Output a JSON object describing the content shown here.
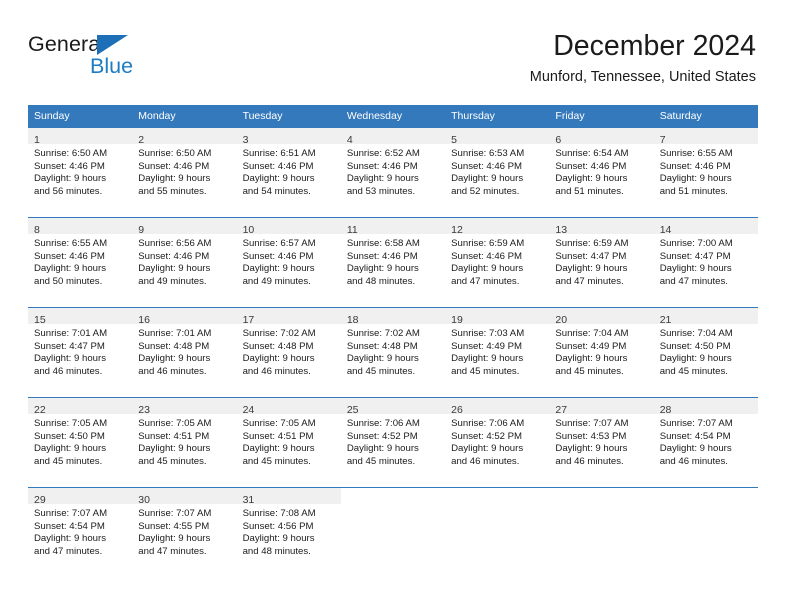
{
  "logo": {
    "text_primary": "General",
    "text_secondary": "Blue",
    "triangle_icon": "triangle-icon",
    "brand_color": "#1d7cc4"
  },
  "header": {
    "title": "December 2024",
    "subtitle": "Munford, Tennessee, United States"
  },
  "colors": {
    "header_blue": "#3579bd",
    "daynum_band": "#f0f0f0",
    "text": "#1b1b1b"
  },
  "calendar": {
    "weekday_headers": [
      "Sunday",
      "Monday",
      "Tuesday",
      "Wednesday",
      "Thursday",
      "Friday",
      "Saturday"
    ],
    "weeks": [
      [
        {
          "day": "1",
          "sunrise": "Sunrise: 6:50 AM",
          "sunset": "Sunset: 4:46 PM",
          "daylight_line1": "Daylight: 9 hours",
          "daylight_line2": "and 56 minutes."
        },
        {
          "day": "2",
          "sunrise": "Sunrise: 6:50 AM",
          "sunset": "Sunset: 4:46 PM",
          "daylight_line1": "Daylight: 9 hours",
          "daylight_line2": "and 55 minutes."
        },
        {
          "day": "3",
          "sunrise": "Sunrise: 6:51 AM",
          "sunset": "Sunset: 4:46 PM",
          "daylight_line1": "Daylight: 9 hours",
          "daylight_line2": "and 54 minutes."
        },
        {
          "day": "4",
          "sunrise": "Sunrise: 6:52 AM",
          "sunset": "Sunset: 4:46 PM",
          "daylight_line1": "Daylight: 9 hours",
          "daylight_line2": "and 53 minutes."
        },
        {
          "day": "5",
          "sunrise": "Sunrise: 6:53 AM",
          "sunset": "Sunset: 4:46 PM",
          "daylight_line1": "Daylight: 9 hours",
          "daylight_line2": "and 52 minutes."
        },
        {
          "day": "6",
          "sunrise": "Sunrise: 6:54 AM",
          "sunset": "Sunset: 4:46 PM",
          "daylight_line1": "Daylight: 9 hours",
          "daylight_line2": "and 51 minutes."
        },
        {
          "day": "7",
          "sunrise": "Sunrise: 6:55 AM",
          "sunset": "Sunset: 4:46 PM",
          "daylight_line1": "Daylight: 9 hours",
          "daylight_line2": "and 51 minutes."
        }
      ],
      [
        {
          "day": "8",
          "sunrise": "Sunrise: 6:55 AM",
          "sunset": "Sunset: 4:46 PM",
          "daylight_line1": "Daylight: 9 hours",
          "daylight_line2": "and 50 minutes."
        },
        {
          "day": "9",
          "sunrise": "Sunrise: 6:56 AM",
          "sunset": "Sunset: 4:46 PM",
          "daylight_line1": "Daylight: 9 hours",
          "daylight_line2": "and 49 minutes."
        },
        {
          "day": "10",
          "sunrise": "Sunrise: 6:57 AM",
          "sunset": "Sunset: 4:46 PM",
          "daylight_line1": "Daylight: 9 hours",
          "daylight_line2": "and 49 minutes."
        },
        {
          "day": "11",
          "sunrise": "Sunrise: 6:58 AM",
          "sunset": "Sunset: 4:46 PM",
          "daylight_line1": "Daylight: 9 hours",
          "daylight_line2": "and 48 minutes."
        },
        {
          "day": "12",
          "sunrise": "Sunrise: 6:59 AM",
          "sunset": "Sunset: 4:46 PM",
          "daylight_line1": "Daylight: 9 hours",
          "daylight_line2": "and 47 minutes."
        },
        {
          "day": "13",
          "sunrise": "Sunrise: 6:59 AM",
          "sunset": "Sunset: 4:47 PM",
          "daylight_line1": "Daylight: 9 hours",
          "daylight_line2": "and 47 minutes."
        },
        {
          "day": "14",
          "sunrise": "Sunrise: 7:00 AM",
          "sunset": "Sunset: 4:47 PM",
          "daylight_line1": "Daylight: 9 hours",
          "daylight_line2": "and 47 minutes."
        }
      ],
      [
        {
          "day": "15",
          "sunrise": "Sunrise: 7:01 AM",
          "sunset": "Sunset: 4:47 PM",
          "daylight_line1": "Daylight: 9 hours",
          "daylight_line2": "and 46 minutes."
        },
        {
          "day": "16",
          "sunrise": "Sunrise: 7:01 AM",
          "sunset": "Sunset: 4:48 PM",
          "daylight_line1": "Daylight: 9 hours",
          "daylight_line2": "and 46 minutes."
        },
        {
          "day": "17",
          "sunrise": "Sunrise: 7:02 AM",
          "sunset": "Sunset: 4:48 PM",
          "daylight_line1": "Daylight: 9 hours",
          "daylight_line2": "and 46 minutes."
        },
        {
          "day": "18",
          "sunrise": "Sunrise: 7:02 AM",
          "sunset": "Sunset: 4:48 PM",
          "daylight_line1": "Daylight: 9 hours",
          "daylight_line2": "and 45 minutes."
        },
        {
          "day": "19",
          "sunrise": "Sunrise: 7:03 AM",
          "sunset": "Sunset: 4:49 PM",
          "daylight_line1": "Daylight: 9 hours",
          "daylight_line2": "and 45 minutes."
        },
        {
          "day": "20",
          "sunrise": "Sunrise: 7:04 AM",
          "sunset": "Sunset: 4:49 PM",
          "daylight_line1": "Daylight: 9 hours",
          "daylight_line2": "and 45 minutes."
        },
        {
          "day": "21",
          "sunrise": "Sunrise: 7:04 AM",
          "sunset": "Sunset: 4:50 PM",
          "daylight_line1": "Daylight: 9 hours",
          "daylight_line2": "and 45 minutes."
        }
      ],
      [
        {
          "day": "22",
          "sunrise": "Sunrise: 7:05 AM",
          "sunset": "Sunset: 4:50 PM",
          "daylight_line1": "Daylight: 9 hours",
          "daylight_line2": "and 45 minutes."
        },
        {
          "day": "23",
          "sunrise": "Sunrise: 7:05 AM",
          "sunset": "Sunset: 4:51 PM",
          "daylight_line1": "Daylight: 9 hours",
          "daylight_line2": "and 45 minutes."
        },
        {
          "day": "24",
          "sunrise": "Sunrise: 7:05 AM",
          "sunset": "Sunset: 4:51 PM",
          "daylight_line1": "Daylight: 9 hours",
          "daylight_line2": "and 45 minutes."
        },
        {
          "day": "25",
          "sunrise": "Sunrise: 7:06 AM",
          "sunset": "Sunset: 4:52 PM",
          "daylight_line1": "Daylight: 9 hours",
          "daylight_line2": "and 45 minutes."
        },
        {
          "day": "26",
          "sunrise": "Sunrise: 7:06 AM",
          "sunset": "Sunset: 4:52 PM",
          "daylight_line1": "Daylight: 9 hours",
          "daylight_line2": "and 46 minutes."
        },
        {
          "day": "27",
          "sunrise": "Sunrise: 7:07 AM",
          "sunset": "Sunset: 4:53 PM",
          "daylight_line1": "Daylight: 9 hours",
          "daylight_line2": "and 46 minutes."
        },
        {
          "day": "28",
          "sunrise": "Sunrise: 7:07 AM",
          "sunset": "Sunset: 4:54 PM",
          "daylight_line1": "Daylight: 9 hours",
          "daylight_line2": "and 46 minutes."
        }
      ],
      [
        {
          "day": "29",
          "sunrise": "Sunrise: 7:07 AM",
          "sunset": "Sunset: 4:54 PM",
          "daylight_line1": "Daylight: 9 hours",
          "daylight_line2": "and 47 minutes."
        },
        {
          "day": "30",
          "sunrise": "Sunrise: 7:07 AM",
          "sunset": "Sunset: 4:55 PM",
          "daylight_line1": "Daylight: 9 hours",
          "daylight_line2": "and 47 minutes."
        },
        {
          "day": "31",
          "sunrise": "Sunrise: 7:08 AM",
          "sunset": "Sunset: 4:56 PM",
          "daylight_line1": "Daylight: 9 hours",
          "daylight_line2": "and 48 minutes."
        },
        null,
        null,
        null,
        null
      ]
    ]
  }
}
